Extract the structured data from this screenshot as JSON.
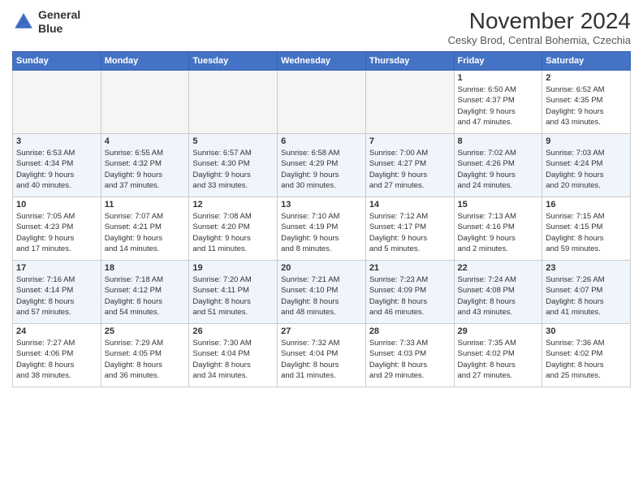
{
  "header": {
    "logo_line1": "General",
    "logo_line2": "Blue",
    "month_title": "November 2024",
    "subtitle": "Cesky Brod, Central Bohemia, Czechia"
  },
  "weekdays": [
    "Sunday",
    "Monday",
    "Tuesday",
    "Wednesday",
    "Thursday",
    "Friday",
    "Saturday"
  ],
  "weeks": [
    [
      {
        "day": "",
        "info": ""
      },
      {
        "day": "",
        "info": ""
      },
      {
        "day": "",
        "info": ""
      },
      {
        "day": "",
        "info": ""
      },
      {
        "day": "",
        "info": ""
      },
      {
        "day": "1",
        "info": "Sunrise: 6:50 AM\nSunset: 4:37 PM\nDaylight: 9 hours\nand 47 minutes."
      },
      {
        "day": "2",
        "info": "Sunrise: 6:52 AM\nSunset: 4:35 PM\nDaylight: 9 hours\nand 43 minutes."
      }
    ],
    [
      {
        "day": "3",
        "info": "Sunrise: 6:53 AM\nSunset: 4:34 PM\nDaylight: 9 hours\nand 40 minutes."
      },
      {
        "day": "4",
        "info": "Sunrise: 6:55 AM\nSunset: 4:32 PM\nDaylight: 9 hours\nand 37 minutes."
      },
      {
        "day": "5",
        "info": "Sunrise: 6:57 AM\nSunset: 4:30 PM\nDaylight: 9 hours\nand 33 minutes."
      },
      {
        "day": "6",
        "info": "Sunrise: 6:58 AM\nSunset: 4:29 PM\nDaylight: 9 hours\nand 30 minutes."
      },
      {
        "day": "7",
        "info": "Sunrise: 7:00 AM\nSunset: 4:27 PM\nDaylight: 9 hours\nand 27 minutes."
      },
      {
        "day": "8",
        "info": "Sunrise: 7:02 AM\nSunset: 4:26 PM\nDaylight: 9 hours\nand 24 minutes."
      },
      {
        "day": "9",
        "info": "Sunrise: 7:03 AM\nSunset: 4:24 PM\nDaylight: 9 hours\nand 20 minutes."
      }
    ],
    [
      {
        "day": "10",
        "info": "Sunrise: 7:05 AM\nSunset: 4:23 PM\nDaylight: 9 hours\nand 17 minutes."
      },
      {
        "day": "11",
        "info": "Sunrise: 7:07 AM\nSunset: 4:21 PM\nDaylight: 9 hours\nand 14 minutes."
      },
      {
        "day": "12",
        "info": "Sunrise: 7:08 AM\nSunset: 4:20 PM\nDaylight: 9 hours\nand 11 minutes."
      },
      {
        "day": "13",
        "info": "Sunrise: 7:10 AM\nSunset: 4:19 PM\nDaylight: 9 hours\nand 8 minutes."
      },
      {
        "day": "14",
        "info": "Sunrise: 7:12 AM\nSunset: 4:17 PM\nDaylight: 9 hours\nand 5 minutes."
      },
      {
        "day": "15",
        "info": "Sunrise: 7:13 AM\nSunset: 4:16 PM\nDaylight: 9 hours\nand 2 minutes."
      },
      {
        "day": "16",
        "info": "Sunrise: 7:15 AM\nSunset: 4:15 PM\nDaylight: 8 hours\nand 59 minutes."
      }
    ],
    [
      {
        "day": "17",
        "info": "Sunrise: 7:16 AM\nSunset: 4:14 PM\nDaylight: 8 hours\nand 57 minutes."
      },
      {
        "day": "18",
        "info": "Sunrise: 7:18 AM\nSunset: 4:12 PM\nDaylight: 8 hours\nand 54 minutes."
      },
      {
        "day": "19",
        "info": "Sunrise: 7:20 AM\nSunset: 4:11 PM\nDaylight: 8 hours\nand 51 minutes."
      },
      {
        "day": "20",
        "info": "Sunrise: 7:21 AM\nSunset: 4:10 PM\nDaylight: 8 hours\nand 48 minutes."
      },
      {
        "day": "21",
        "info": "Sunrise: 7:23 AM\nSunset: 4:09 PM\nDaylight: 8 hours\nand 46 minutes."
      },
      {
        "day": "22",
        "info": "Sunrise: 7:24 AM\nSunset: 4:08 PM\nDaylight: 8 hours\nand 43 minutes."
      },
      {
        "day": "23",
        "info": "Sunrise: 7:26 AM\nSunset: 4:07 PM\nDaylight: 8 hours\nand 41 minutes."
      }
    ],
    [
      {
        "day": "24",
        "info": "Sunrise: 7:27 AM\nSunset: 4:06 PM\nDaylight: 8 hours\nand 38 minutes."
      },
      {
        "day": "25",
        "info": "Sunrise: 7:29 AM\nSunset: 4:05 PM\nDaylight: 8 hours\nand 36 minutes."
      },
      {
        "day": "26",
        "info": "Sunrise: 7:30 AM\nSunset: 4:04 PM\nDaylight: 8 hours\nand 34 minutes."
      },
      {
        "day": "27",
        "info": "Sunrise: 7:32 AM\nSunset: 4:04 PM\nDaylight: 8 hours\nand 31 minutes."
      },
      {
        "day": "28",
        "info": "Sunrise: 7:33 AM\nSunset: 4:03 PM\nDaylight: 8 hours\nand 29 minutes."
      },
      {
        "day": "29",
        "info": "Sunrise: 7:35 AM\nSunset: 4:02 PM\nDaylight: 8 hours\nand 27 minutes."
      },
      {
        "day": "30",
        "info": "Sunrise: 7:36 AM\nSunset: 4:02 PM\nDaylight: 8 hours\nand 25 minutes."
      }
    ]
  ]
}
